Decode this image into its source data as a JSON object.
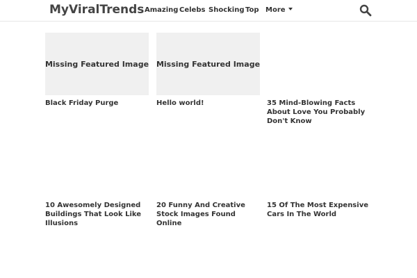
{
  "header": {
    "logo": "MyViralTrends",
    "nav": [
      {
        "label": "Amazing"
      },
      {
        "label": "Celebs"
      },
      {
        "label": "Shocking"
      },
      {
        "label": "Top"
      },
      {
        "label": "More"
      }
    ],
    "search_icon": "search-icon"
  },
  "posts": [
    {
      "title": "Black Friday Purge",
      "thumb_text": "Missing Featured Image"
    },
    {
      "title": "Hello world!",
      "thumb_text": "Missing Featured Image"
    },
    {
      "title": "35 Mind-Blowing Facts About Love You Probably Don't Know",
      "thumb_text": ""
    },
    {
      "title": "10 Awesomely Designed Buildings That Look Like Illusions",
      "thumb_text": ""
    },
    {
      "title": "20 Funny And Creative Stock Images Found Online",
      "thumb_text": ""
    },
    {
      "title": "15 Of The Most Expensive Cars In The World",
      "thumb_text": ""
    }
  ],
  "colors": {
    "thumb_placeholder": "#f0f0f0",
    "text": "#333333",
    "logo": "#444444"
  }
}
